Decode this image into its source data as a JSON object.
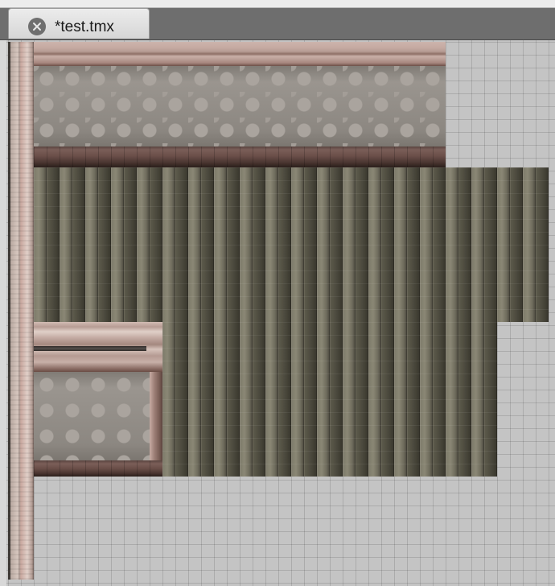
{
  "tabs": [
    {
      "label": "*test.tmx",
      "active": true,
      "modified": true
    }
  ],
  "icons": {
    "tab_close": "close-circle-icon"
  },
  "colors": {
    "tabbar_bg": "#6e6e6e",
    "active_tab_bg": "#e4e4e4",
    "canvas_bg": "#c4c4c4"
  },
  "map": {
    "tiles": [
      "left-wall-pillar",
      "top-wall",
      "wooden-floor",
      "small-room-wall"
    ]
  }
}
